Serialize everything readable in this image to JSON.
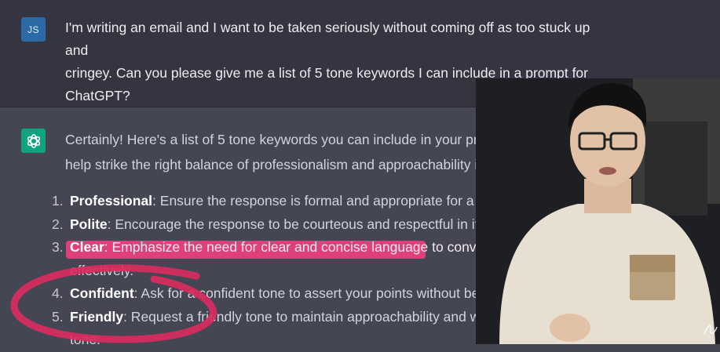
{
  "user": {
    "avatar_initials": "JS",
    "lines": [
      "I'm writing an email and I want to be taken seriously without coming off as too stuck up and",
      "cringey. Can you please give me a list of 5 tone keywords I can include in a prompt for",
      "ChatGPT?"
    ]
  },
  "assistant": {
    "avatar_icon": "openai-logo-icon",
    "intro_lines": [
      "Certainly! Here's a list of 5 tone keywords you can include in your prom",
      "help strike the right balance of professionalism and approachability in"
    ],
    "items": [
      {
        "number": "1.",
        "keyword": "Professional",
        "rest": ": Ensure the response is formal and appropriate for a bus"
      },
      {
        "number": "2.",
        "keyword": "Polite",
        "rest": ": Encourage the response to be courteous and respectful in its to"
      },
      {
        "number": "3.",
        "keyword": "Clear",
        "rest": ": Emphasize the need for clear and concise language to convey t",
        "continuation": "effectively."
      },
      {
        "number": "4.",
        "keyword": "Confident",
        "rest": ": Ask for a confident tone to assert your points without being"
      },
      {
        "number": "5.",
        "keyword": "Friendly",
        "rest": ": Request a friendly tone to maintain approachability and warr",
        "continuation": "tone."
      }
    ]
  },
  "annotations": {
    "highlight_color": "#e0407a",
    "circle_color": "#d92d5f"
  },
  "colors": {
    "user_bg": "#343541",
    "assistant_bg": "#444654",
    "user_avatar": "#2b6aa7",
    "bot_avatar": "#10a37f"
  }
}
